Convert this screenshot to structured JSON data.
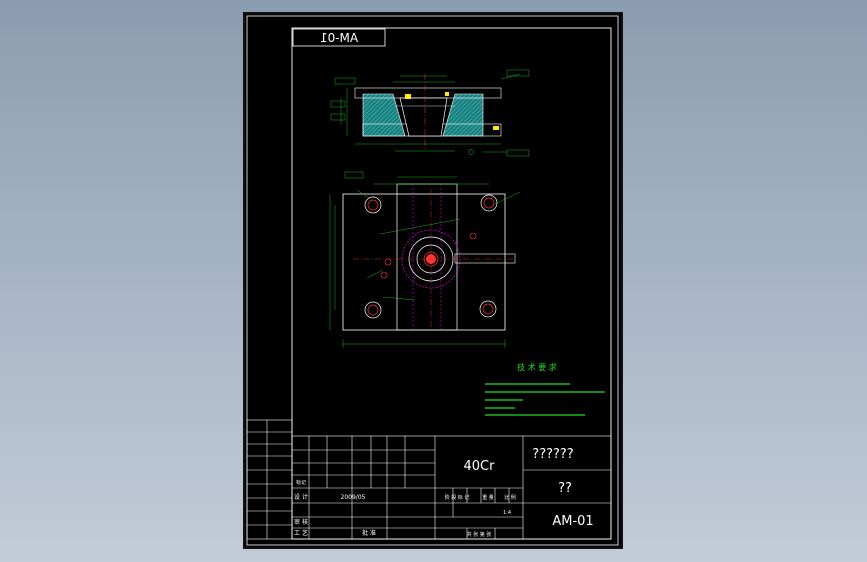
{
  "drawing": {
    "part_number_top": "AM-01",
    "part_number": "AM-01",
    "material": "40Cr",
    "part_name": "??????",
    "company": "??",
    "scale": "1:4",
    "date_text": "2009/05",
    "tech_title": "技 术 要 求",
    "title_block": {
      "design_label": "设 计",
      "revision_label": "标记",
      "process_label": "工 艺",
      "check_label": "审 核",
      "approve_label": "批 准",
      "stage_label": "阶 段 标 记",
      "weight_label": "重 量",
      "scale_label": "比 例",
      "sheet_label": "共 张 第 张"
    }
  },
  "colors": {
    "background": "#8c9cb0",
    "sheet": "#000000",
    "frame": "#ffffff",
    "outline": "#ffffff",
    "dimension": "#22dd22",
    "center_line": "#ff3333",
    "hidden_line": "#ff00ff",
    "section_hatch": "#2aa0a0",
    "yellow": "#ffee00"
  }
}
